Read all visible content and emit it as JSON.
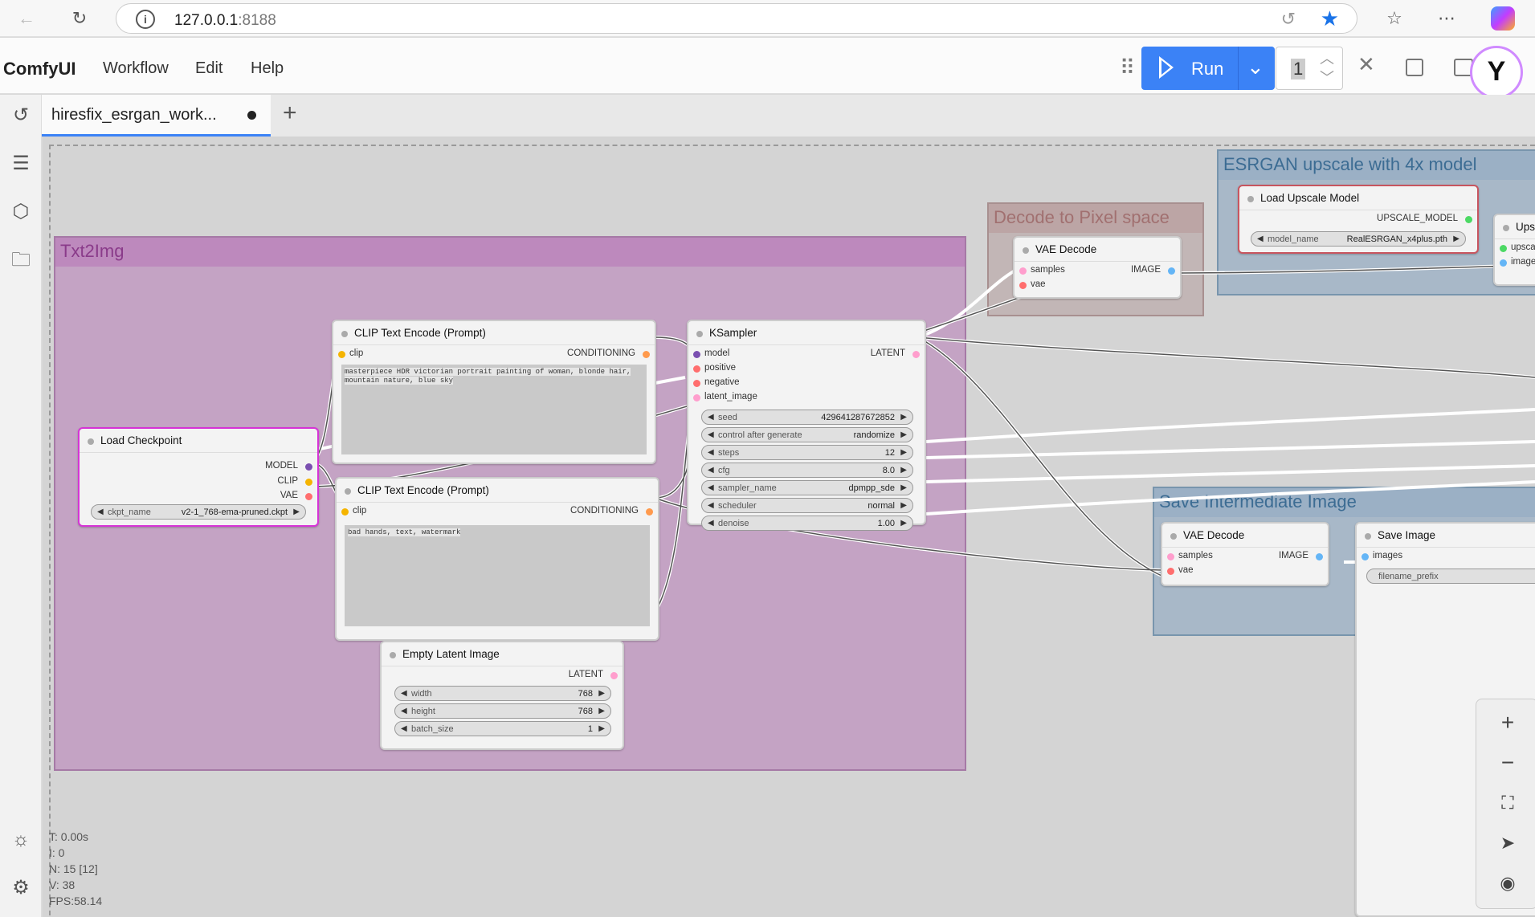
{
  "browser": {
    "url_host": "127.0.0.1",
    "url_port": ":8188"
  },
  "app": {
    "logo": "ComfyUI",
    "menu": [
      "Workflow",
      "Edit",
      "Help"
    ],
    "run_label": "Run",
    "queue_count": "1"
  },
  "tabs": [
    {
      "label": "hiresfix_esrgan_work...",
      "modified": true
    }
  ],
  "groups": {
    "txt2img": "Txt2Img",
    "decode": "Decode to Pixel space",
    "esrgan": "ESRGAN upscale with 4x model",
    "save_intermediate": "Save Intermediate Image"
  },
  "nodes": {
    "load_checkpoint": {
      "title": "Load Checkpoint",
      "outputs": [
        "MODEL",
        "CLIP",
        "VAE"
      ],
      "widget_name": "ckpt_name",
      "widget_value": "v2-1_768-ema-pruned.ckpt"
    },
    "clip_pos": {
      "title": "CLIP Text Encode (Prompt)",
      "input": "clip",
      "output": "CONDITIONING",
      "text": "masterpiece HDR victorian portrait painting of woman, blonde hair, mountain nature, blue sky"
    },
    "clip_neg": {
      "title": "CLIP Text Encode (Prompt)",
      "input": "clip",
      "output": "CONDITIONING",
      "text": "bad hands, text, watermark"
    },
    "empty_latent": {
      "title": "Empty Latent Image",
      "output": "LATENT",
      "widgets": [
        {
          "name": "width",
          "value": "768"
        },
        {
          "name": "height",
          "value": "768"
        },
        {
          "name": "batch_size",
          "value": "1"
        }
      ]
    },
    "ksampler": {
      "title": "KSampler",
      "inputs": [
        "model",
        "positive",
        "negative",
        "latent_image"
      ],
      "output": "LATENT",
      "widgets": [
        {
          "name": "seed",
          "value": "429641287672852"
        },
        {
          "name": "control after generate",
          "value": "randomize"
        },
        {
          "name": "steps",
          "value": "12"
        },
        {
          "name": "cfg",
          "value": "8.0"
        },
        {
          "name": "sampler_name",
          "value": "dpmpp_sde"
        },
        {
          "name": "scheduler",
          "value": "normal"
        },
        {
          "name": "denoise",
          "value": "1.00"
        }
      ]
    },
    "vae_decode_1": {
      "title": "VAE Decode",
      "inputs": [
        "samples",
        "vae"
      ],
      "output": "IMAGE"
    },
    "load_upscale": {
      "title": "Load Upscale Model",
      "output": "UPSCALE_MODEL",
      "widget_name": "model_name",
      "widget_value": "RealESRGAN_x4plus.pth"
    },
    "upscale_partial": {
      "title": "Ups",
      "inputs": [
        "upsca",
        "image"
      ]
    },
    "vae_decode_2": {
      "title": "VAE Decode",
      "inputs": [
        "samples",
        "vae"
      ],
      "output": "IMAGE"
    },
    "save_image": {
      "title": "Save Image",
      "input": "images",
      "widget_name": "filename_prefix"
    }
  },
  "stats": [
    "T: 0.00s",
    "I: 0",
    "N: 15 [12]",
    "V: 38",
    "FPS:58.14"
  ],
  "colors": {
    "accent": "#3b82f6",
    "txt2img_group": "#c8a9c8",
    "decode_group": "#bba7a7",
    "esrgan_group": "#a3b5c7",
    "port_model": "#7a4fb0",
    "port_clip": "#f5b400",
    "port_vae": "#ff6e6e",
    "port_cond": "#ff9a4d",
    "port_latent": "#ff9ecd",
    "port_image": "#64b5f6",
    "port_upscale": "#4cd964"
  }
}
